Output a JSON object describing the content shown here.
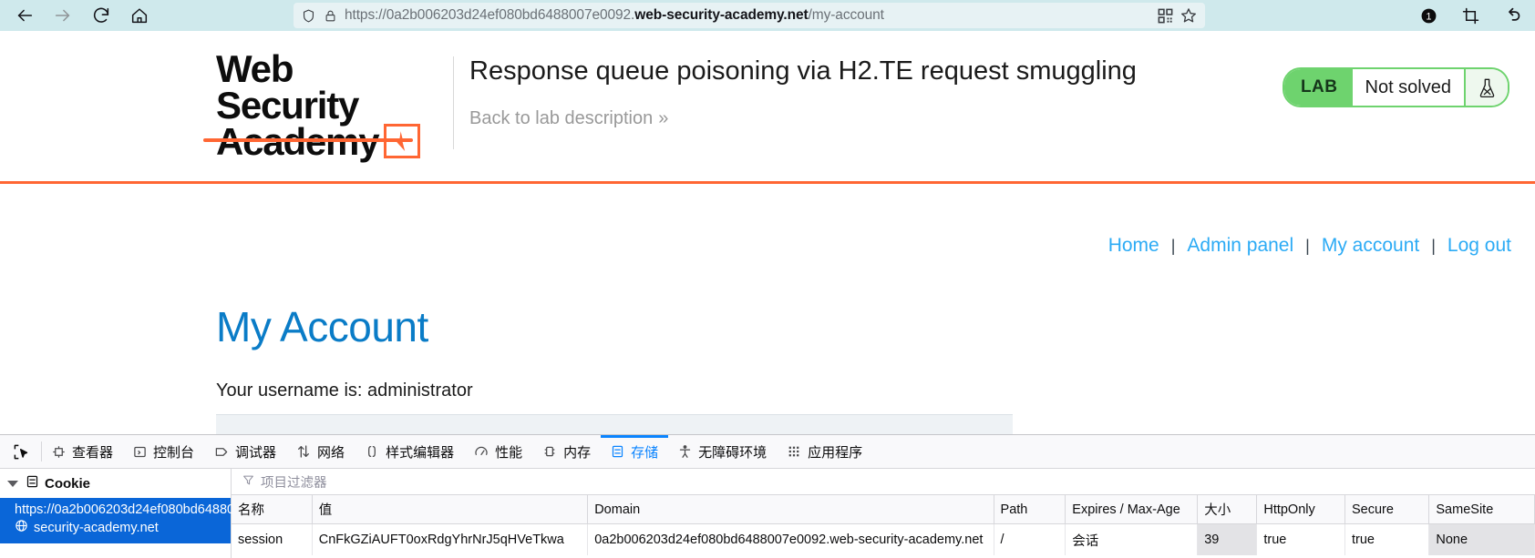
{
  "browser": {
    "back_icon": "arrow-left-icon",
    "forward_icon": "arrow-right-icon",
    "reload_icon": "reload-icon",
    "home_icon": "home-icon",
    "shield_icon": "shield-icon",
    "lock_icon": "lock-icon",
    "url_prefix": "https://0a2b006203d24ef080bd6488007e0092.",
    "url_domain": "web-security-academy.net",
    "url_path": "/my-account",
    "qr_icon": "qr-code-icon",
    "bookmark_icon": "star-icon",
    "badge_icon": "notification-badge-icon",
    "screenshot_icon": "crop-screenshot-icon",
    "undo_icon": "undo-arrow-icon"
  },
  "lab": {
    "logo_line1": "Web Security",
    "logo_line2": "Academy",
    "title": "Response queue poisoning via H2.TE request smuggling",
    "back_label": "Back to lab description",
    "back_chevron": "»",
    "status_tag": "LAB",
    "status_state": "Not solved",
    "flask_icon": "flask-icon",
    "accent_color": "#ff6633",
    "status_green": "#6ed36e"
  },
  "site": {
    "nav": [
      {
        "label": "Home"
      },
      {
        "label": "Admin panel"
      },
      {
        "label": "My account"
      },
      {
        "label": "Log out"
      }
    ],
    "nav_separator": "|",
    "page_title": "My Account",
    "username_line": "Your username is: administrator"
  },
  "devtools": {
    "picker_icon": "element-picker-icon",
    "tabs": [
      {
        "label": "查看器",
        "icon": "inspector-icon",
        "active": false
      },
      {
        "label": "控制台",
        "icon": "console-icon",
        "active": false
      },
      {
        "label": "调试器",
        "icon": "debugger-icon",
        "active": false
      },
      {
        "label": "网络",
        "icon": "network-icon",
        "active": false
      },
      {
        "label": "样式编辑器",
        "icon": "style-editor-icon",
        "active": false
      },
      {
        "label": "性能",
        "icon": "performance-icon",
        "active": false
      },
      {
        "label": "内存",
        "icon": "memory-icon",
        "active": false
      },
      {
        "label": "存储",
        "icon": "storage-icon",
        "active": true
      },
      {
        "label": "无障碍环境",
        "icon": "accessibility-icon",
        "active": false
      },
      {
        "label": "应用程序",
        "icon": "application-icon",
        "active": false
      }
    ],
    "sidebar": {
      "root_label": "Cookie",
      "root_icon": "storage-icon",
      "globe_icon": "globe-icon",
      "selected_url_line1": "https://0a2b006203d24ef080bd648800",
      "selected_url_line2": "security-academy.net"
    },
    "filter_placeholder": "项目过滤器",
    "filter_icon": "funnel-icon",
    "table": {
      "headers": [
        "名称",
        "值",
        "Domain",
        "Path",
        "Expires / Max-Age",
        "大小",
        "HttpOnly",
        "Secure",
        "SameSite"
      ],
      "rows": [
        {
          "name": "session",
          "value": "CnFkGZiAUFT0oxRdgYhrNrJ5qHVeTkwa",
          "domain": "0a2b006203d24ef080bd6488007e0092.web-security-academy.net",
          "path": "/",
          "expires": "会话",
          "size": "39",
          "http_only": "true",
          "secure": "true",
          "same_site": "None"
        }
      ]
    }
  }
}
